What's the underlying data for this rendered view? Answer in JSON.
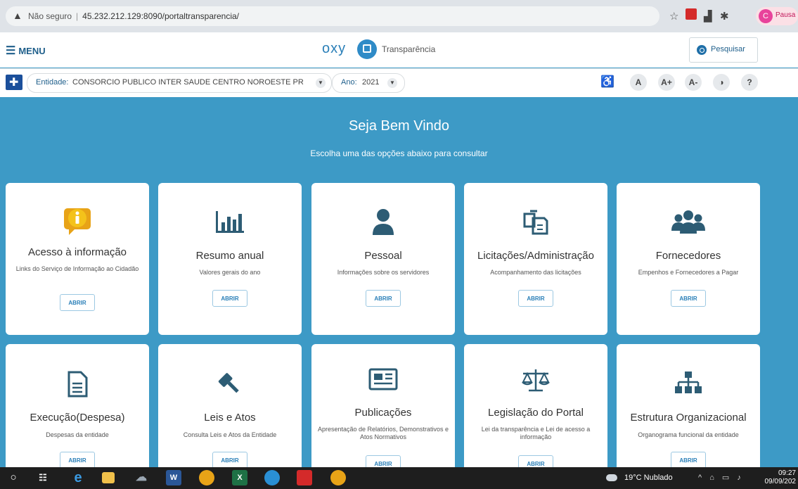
{
  "browser": {
    "security_label": "Não seguro",
    "url": "45.232.212.129:8090/portaltransparencia/",
    "profile_initial": "C",
    "profile_label": "Pausa"
  },
  "header": {
    "menu_label": "MENU",
    "logo_text": "oxy",
    "logo_name": "Transparência",
    "search_label": "Pesquisar"
  },
  "entity_bar": {
    "entidade_label": "Entidade:",
    "entidade_value": "CONSORCIO PUBLICO INTER SAUDE CENTRO NOROESTE PR",
    "ano_label": "Ano:",
    "ano_value": "2021",
    "accessibility": [
      "A",
      "A+",
      "A-",
      "?"
    ]
  },
  "hero": {
    "title": "Seja Bem Vindo",
    "subtitle": "Escolha uma das opções abaixo para consultar"
  },
  "cards": [
    {
      "title": "Acesso à informação",
      "desc": "Links do Serviço de Informação ao Cidadão",
      "button": "ABRIR",
      "icon": "info-icon"
    },
    {
      "title": "Resumo anual",
      "desc": "Valores gerais do ano",
      "button": "ABRIR",
      "icon": "bar-chart-icon"
    },
    {
      "title": "Pessoal",
      "desc": "Informações sobre os servidores",
      "button": "ABRIR",
      "icon": "person-icon"
    },
    {
      "title": "Licitações/Administração",
      "desc": "Acompanhamento das licitações",
      "button": "ABRIR",
      "icon": "documents-icon"
    },
    {
      "title": "Fornecedores",
      "desc": "Empenhos e Fornecedores a Pagar",
      "button": "ABRIR",
      "icon": "group-icon"
    },
    {
      "title": "Execução(Despesa)",
      "desc": "Despesas da entidade",
      "button": "ABRIR",
      "icon": "file-icon"
    },
    {
      "title": "Leis e Atos",
      "desc": "Consulta Leis e Atos da Entidade",
      "button": "ABRIR",
      "icon": "gavel-icon"
    },
    {
      "title": "Publicações",
      "desc": "Apresentação de Relatórios, Demonstrativos e Atos Normativos",
      "button": "ABRIR",
      "icon": "newspaper-icon"
    },
    {
      "title": "Legislação do Portal",
      "desc": "Lei da transparência e Lei de acesso a informação",
      "button": "ABRIR",
      "icon": "scales-icon"
    },
    {
      "title": "Estrutura Organizacional",
      "desc": "Organograma funcional da entidade",
      "button": "ABRIR",
      "icon": "org-chart-icon"
    }
  ],
  "taskbar": {
    "weather": "19°C  Nublado",
    "time": "09:27",
    "date": "09/09/202"
  },
  "colors": {
    "hero_bg": "#3d9ac6",
    "accent": "#2a7fb8",
    "icon_dark": "#2d5c74"
  }
}
